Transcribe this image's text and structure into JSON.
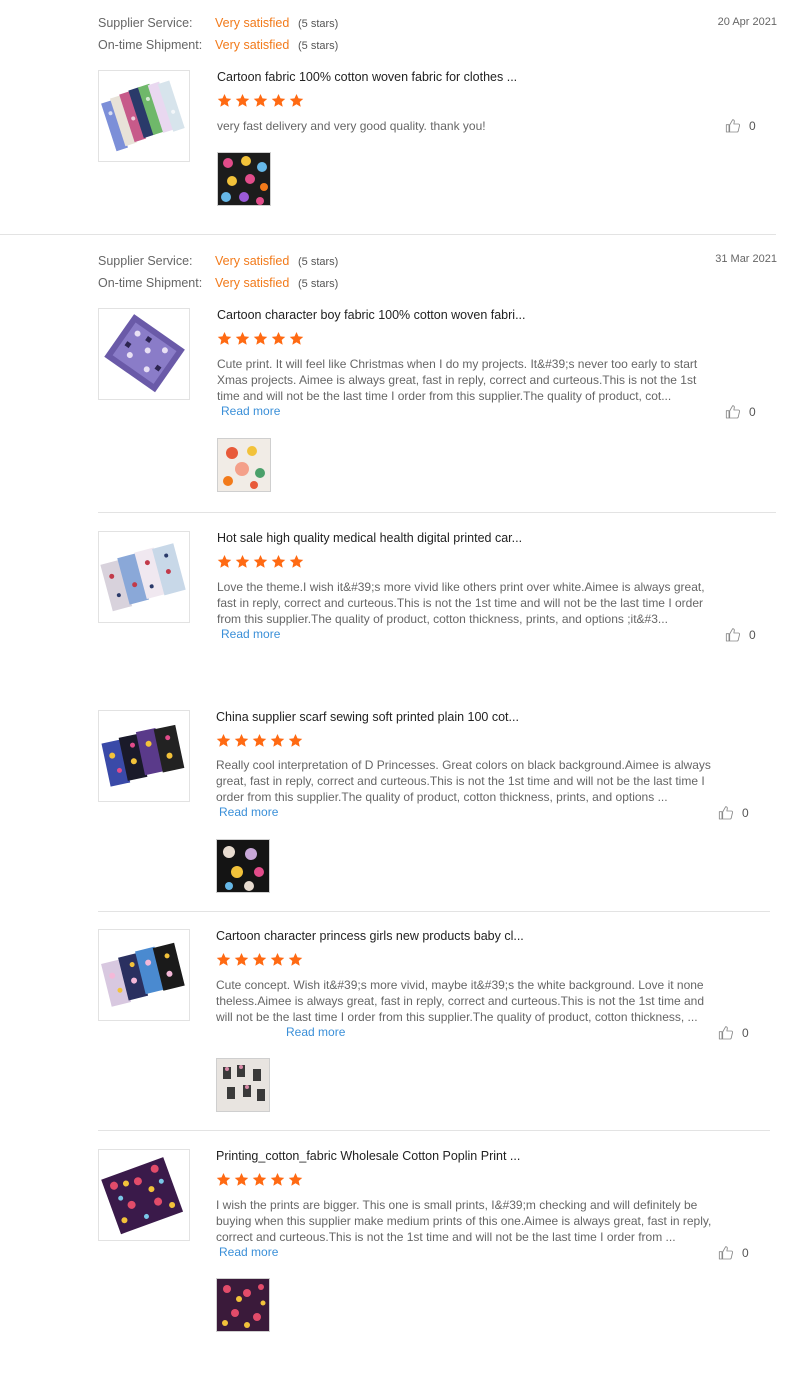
{
  "colors": {
    "accent": "#f27a1a",
    "star": "#ff6a13",
    "link": "#3a8fd8"
  },
  "review1": {
    "service_label": "Supplier Service:",
    "service_value": "Very satisfied",
    "service_stars": "(5 stars)",
    "shipment_label": "On-time Shipment:",
    "shipment_value": "Very satisfied",
    "shipment_stars": "(5 stars)",
    "date": "20 Apr 2021",
    "product_title": "Cartoon fabric 100% cotton woven fabric for clothes ...",
    "rating": 5,
    "text": "very fast delivery and very good quality. thank you!",
    "likes": "0"
  },
  "review2": {
    "service_label": "Supplier Service:",
    "service_value": "Very satisfied",
    "service_stars": "(5 stars)",
    "shipment_label": "On-time Shipment:",
    "shipment_value": "Very satisfied",
    "shipment_stars": "(5 stars)",
    "date": "31 Mar 2021",
    "items": [
      {
        "title": "Cartoon character boy fabric 100% cotton woven fabri...",
        "rating": 5,
        "text": "Cute print. It will feel like Christmas when I do my projects. It&#39;s never too early to start Xmas projects. Aimee is always great, fast in reply, correct and curteous.This is not the 1st time and will not be the last time I order from this supplier.The quality of product, cot...",
        "read_more": "Read more",
        "likes": "0"
      },
      {
        "title": "Hot sale high quality medical health digital printed car...",
        "rating": 5,
        "text": "Love the theme.I wish it&#39;s more vivid like others print over white.Aimee is always great, fast in reply, correct and curteous.This is not the 1st time and will not be the last time I order from this supplier.The quality of product, cotton thickness, prints, and options ;it&#3...",
        "read_more": "Read more",
        "likes": "0"
      },
      {
        "title": "China supplier scarf sewing soft printed plain 100 cot...",
        "rating": 5,
        "text": "Really cool interpretation of D Princesses. Great colors on black background.Aimee is always great, fast in reply, correct and curteous.This is not the 1st time and will not be the last time I order from this supplier.The quality of product, cotton thickness, prints, and options ...",
        "read_more": "Read more",
        "likes": "0"
      },
      {
        "title": "Cartoon character princess girls new products baby cl...",
        "rating": 5,
        "text": "Cute concept. Wish it&#39;s more vivid, maybe it&#39;s the white background. Love it none theless.Aimee is always great, fast in reply, correct and curteous.This is not the 1st time and will not be the last time I order from this supplier.The quality of product, cotton thickness, ...",
        "read_more": "Read more",
        "likes": "0"
      },
      {
        "title": "Printing_cotton_fabric Wholesale Cotton Poplin Print ...",
        "rating": 5,
        "text": "I wish the prints are bigger. This one is small prints, I&#39;m checking and will definitely be buying when this supplier make medium prints of this one.Aimee is always great, fast in reply, correct and curteous.This is not the 1st time and will not be the last time I order from ...",
        "read_more": "Read more",
        "likes": "0"
      }
    ]
  }
}
